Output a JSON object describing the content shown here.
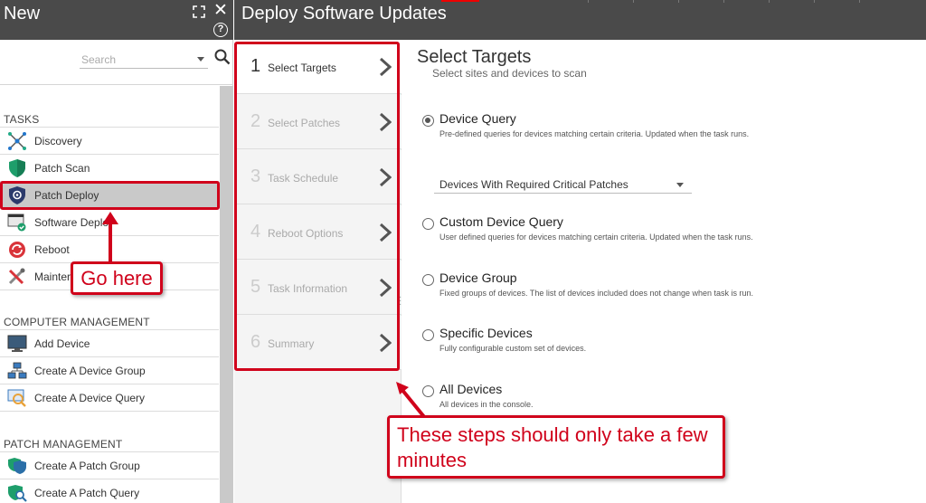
{
  "left_panel": {
    "title": "New",
    "search": {
      "placeholder": "Search"
    },
    "sections": [
      {
        "header": "TASKS",
        "items": [
          {
            "label": "Discovery",
            "icon": "discovery-icon"
          },
          {
            "label": "Patch Scan",
            "icon": "shield-icon"
          },
          {
            "label": "Patch Deploy",
            "icon": "shield-gear-icon",
            "active": true
          },
          {
            "label": "Software Deplo",
            "icon": "software-deploy-icon"
          },
          {
            "label": "Reboot",
            "icon": "reboot-icon"
          },
          {
            "label": "Mainter",
            "icon": "maintenance-icon"
          }
        ]
      },
      {
        "header": "COMPUTER MANAGEMENT",
        "items": [
          {
            "label": "Add Device",
            "icon": "monitor-icon"
          },
          {
            "label": "Create A Device Group",
            "icon": "device-group-icon"
          },
          {
            "label": "Create A Device Query",
            "icon": "device-query-icon"
          }
        ]
      },
      {
        "header": "PATCH MANAGEMENT",
        "items": [
          {
            "label": "Create A Patch Group",
            "icon": "patch-group-icon"
          },
          {
            "label": "Create A Patch Query",
            "icon": "patch-query-icon"
          }
        ]
      }
    ]
  },
  "main": {
    "title": "Deploy Software Updates",
    "steps": [
      {
        "num": "1",
        "label": "Select Targets",
        "current": true
      },
      {
        "num": "2",
        "label": "Select Patches"
      },
      {
        "num": "3",
        "label": "Task Schedule"
      },
      {
        "num": "4",
        "label": "Reboot Options"
      },
      {
        "num": "5",
        "label": "Task Information"
      },
      {
        "num": "6",
        "label": "Summary"
      }
    ],
    "content": {
      "title": "Select Targets",
      "subtitle": "Select sites and devices to scan",
      "options": [
        {
          "label": "Device Query",
          "desc": "Pre-defined queries for devices matching certain criteria. Updated when the task runs.",
          "checked": true
        },
        {
          "label": "Custom Device Query",
          "desc": "User defined queries for devices matching certain criteria. Updated when the task runs."
        },
        {
          "label": "Device Group",
          "desc": "Fixed groups of devices. The list of devices included does not change when task is run."
        },
        {
          "label": "Specific Devices",
          "desc": "Fully configurable custom set of devices."
        },
        {
          "label": "All Devices",
          "desc": "All devices in the console."
        }
      ],
      "query_select": {
        "value": "Devices With Required Critical Patches"
      }
    }
  },
  "annotations": {
    "go_here": "Go here",
    "steps_note": "These steps should only take a few minutes"
  },
  "colors": {
    "header_bg": "#4a4a4a",
    "annotation_red": "#d0021b",
    "active_item_bg": "#c9c9c9"
  }
}
